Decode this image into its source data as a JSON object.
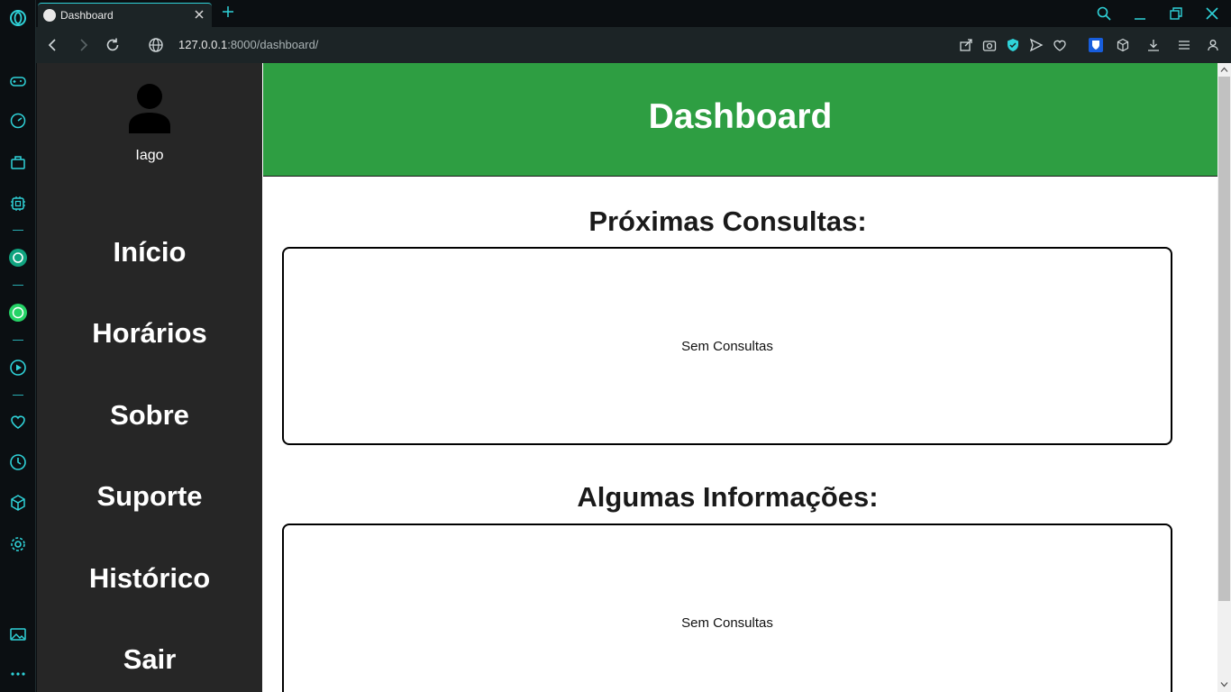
{
  "browser": {
    "tab_title": "Dashboard",
    "url_host": "127.0.0.1",
    "url_rest": ":8000/dashboard/",
    "accent_color": "#2fd3d9",
    "side_icons": [
      "opera-logo-icon",
      "gamepad-icon",
      "speedometer-icon",
      "bag-icon",
      "chip-icon",
      "chatgpt-icon",
      "whatsapp-icon",
      "play-icon",
      "heart-icon",
      "clock-icon",
      "cube-icon",
      "gear-icon",
      "gallery-icon",
      "more-icon"
    ]
  },
  "sidebar": {
    "username": "Iago",
    "items": [
      {
        "label": "Início"
      },
      {
        "label": "Horários"
      },
      {
        "label": "Sobre"
      },
      {
        "label": "Suporte"
      },
      {
        "label": "Histórico"
      },
      {
        "label": "Sair"
      }
    ]
  },
  "header": {
    "title": "Dashboard",
    "color": "#2e9e42"
  },
  "sections": [
    {
      "title": "Próximas Consultas:",
      "content": "Sem Consultas"
    },
    {
      "title": "Algumas Informações:",
      "content": "Sem Consultas"
    }
  ]
}
